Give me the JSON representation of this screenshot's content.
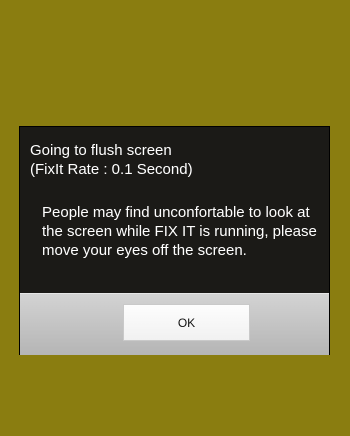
{
  "dialog": {
    "title": "Going to flush screen\n(FixIt Rate : 0.1 Second)",
    "message": "People may find unconfortable to look at the screen while FIX IT is running, please move your eyes off the screen.",
    "ok_label": "OK"
  },
  "colors": {
    "background": "#8a7d10",
    "dialog_bg": "#1b1a17",
    "button_bar": "#c4c4c4"
  }
}
